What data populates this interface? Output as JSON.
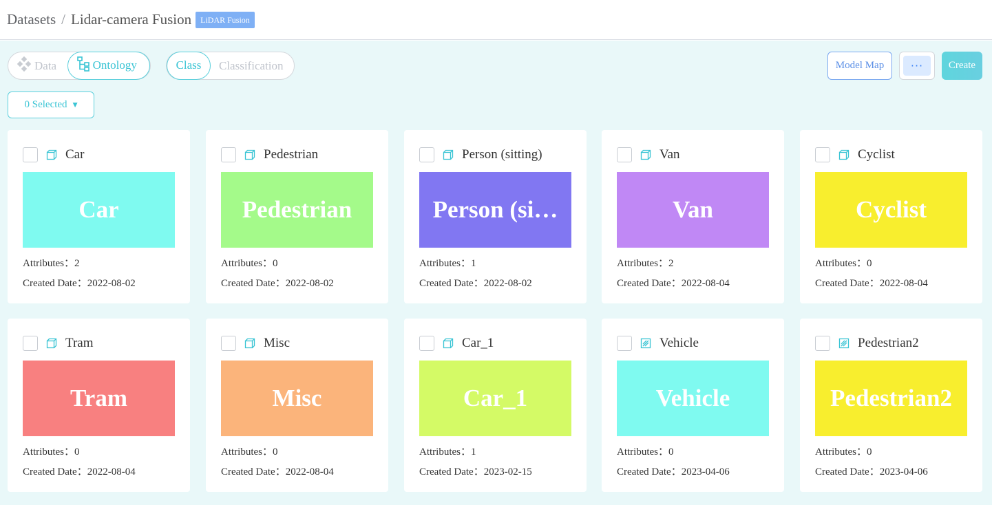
{
  "breadcrumb": {
    "root": "Datasets",
    "separator": "/",
    "current": "Lidar-camera Fusion",
    "tag": "LiDAR Fusion"
  },
  "toolbar": {
    "data_label": "Data",
    "ontology_label": "Ontology",
    "class_label": "Class",
    "classification_label": "Classification",
    "model_map_label": "Model Map",
    "more_label": "···",
    "create_label": "Create",
    "selected_label": "0 Selected"
  },
  "labels": {
    "attributes": "Attributes：",
    "created_date": "Created Date："
  },
  "colors": {
    "accent": "#39c4d4",
    "background": "#e9f8f9"
  },
  "classes": [
    {
      "name": "Car",
      "swatch_text": "Car",
      "color": "#7ffaf0",
      "icon": "cube-icon",
      "attributes": "2",
      "created": "2022-08-02"
    },
    {
      "name": "Pedestrian",
      "swatch_text": "Pedestrian",
      "color": "#a4fa8a",
      "icon": "cube-icon",
      "attributes": "0",
      "created": "2022-08-02"
    },
    {
      "name": "Person (sitting)",
      "swatch_text": "Person (si…",
      "color": "#8177f2",
      "icon": "cube-icon",
      "attributes": "1",
      "created": "2022-08-02"
    },
    {
      "name": "Van",
      "swatch_text": "Van",
      "color": "#c088f5",
      "icon": "cube-icon",
      "attributes": "2",
      "created": "2022-08-04"
    },
    {
      "name": "Cyclist",
      "swatch_text": "Cyclist",
      "color": "#f8ee2e",
      "icon": "cube-icon",
      "attributes": "0",
      "created": "2022-08-04"
    },
    {
      "name": "Tram",
      "swatch_text": "Tram",
      "color": "#f88080",
      "icon": "cube-icon",
      "attributes": "0",
      "created": "2022-08-04"
    },
    {
      "name": "Misc",
      "swatch_text": "Misc",
      "color": "#fbb47b",
      "icon": "cube-icon",
      "attributes": "0",
      "created": "2022-08-04"
    },
    {
      "name": "Car_1",
      "swatch_text": "Car_1",
      "color": "#d4fa66",
      "icon": "cube-icon",
      "attributes": "1",
      "created": "2023-02-15"
    },
    {
      "name": "Vehicle",
      "swatch_text": "Vehicle",
      "color": "#7ffaf0",
      "icon": "box2d-icon",
      "attributes": "0",
      "created": "2023-04-06"
    },
    {
      "name": "Pedestrian2",
      "swatch_text": "Pedestrian2",
      "color": "#f8ee2e",
      "icon": "box2d-icon",
      "attributes": "0",
      "created": "2023-04-06"
    }
  ]
}
